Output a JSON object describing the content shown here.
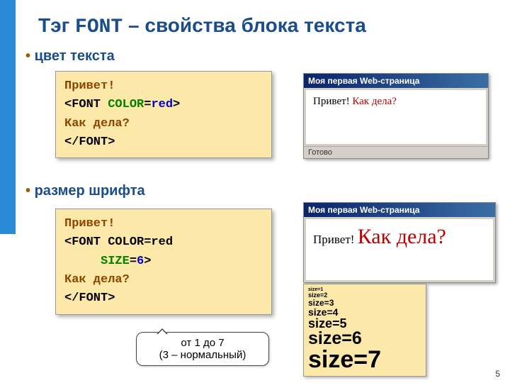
{
  "title": {
    "pre": "Тэг ",
    "mono": "FONT",
    "post": " – свойства блока текста"
  },
  "bullets": {
    "color": "цвет текста",
    "size": "размер шрифта"
  },
  "code1": {
    "l1a": "Привет!",
    "l2a": "<FONT ",
    "l2b": "COLOR",
    "l2c": "=",
    "l2d": "red",
    "l2e": ">",
    "l3a": "Как дела?",
    "l4a": "</FONT>"
  },
  "code2": {
    "l1a": "Привет!",
    "l2a": "<FONT COLOR=red",
    "l3a": "     ",
    "l3b": "SIZE",
    "l3c": "=",
    "l3d": "6",
    "l3e": ">",
    "l4a": "Как дела?",
    "l5a": "</FONT>"
  },
  "browser": {
    "titlebar": "Моя первая Web-страница",
    "status": "Готово",
    "sample1": {
      "t1": "Привет! ",
      "t2": "Как дела?"
    },
    "sample2": {
      "t1": "Привет! ",
      "t2": "Как дела?"
    }
  },
  "sizes": [
    "size=1",
    "size=2",
    "size=3",
    "size=4",
    "size=5",
    "size=6",
    "size=7"
  ],
  "callout": {
    "line1": "от 1 до 7",
    "line2": "(3 – нормальный)"
  },
  "pagenum": "5"
}
